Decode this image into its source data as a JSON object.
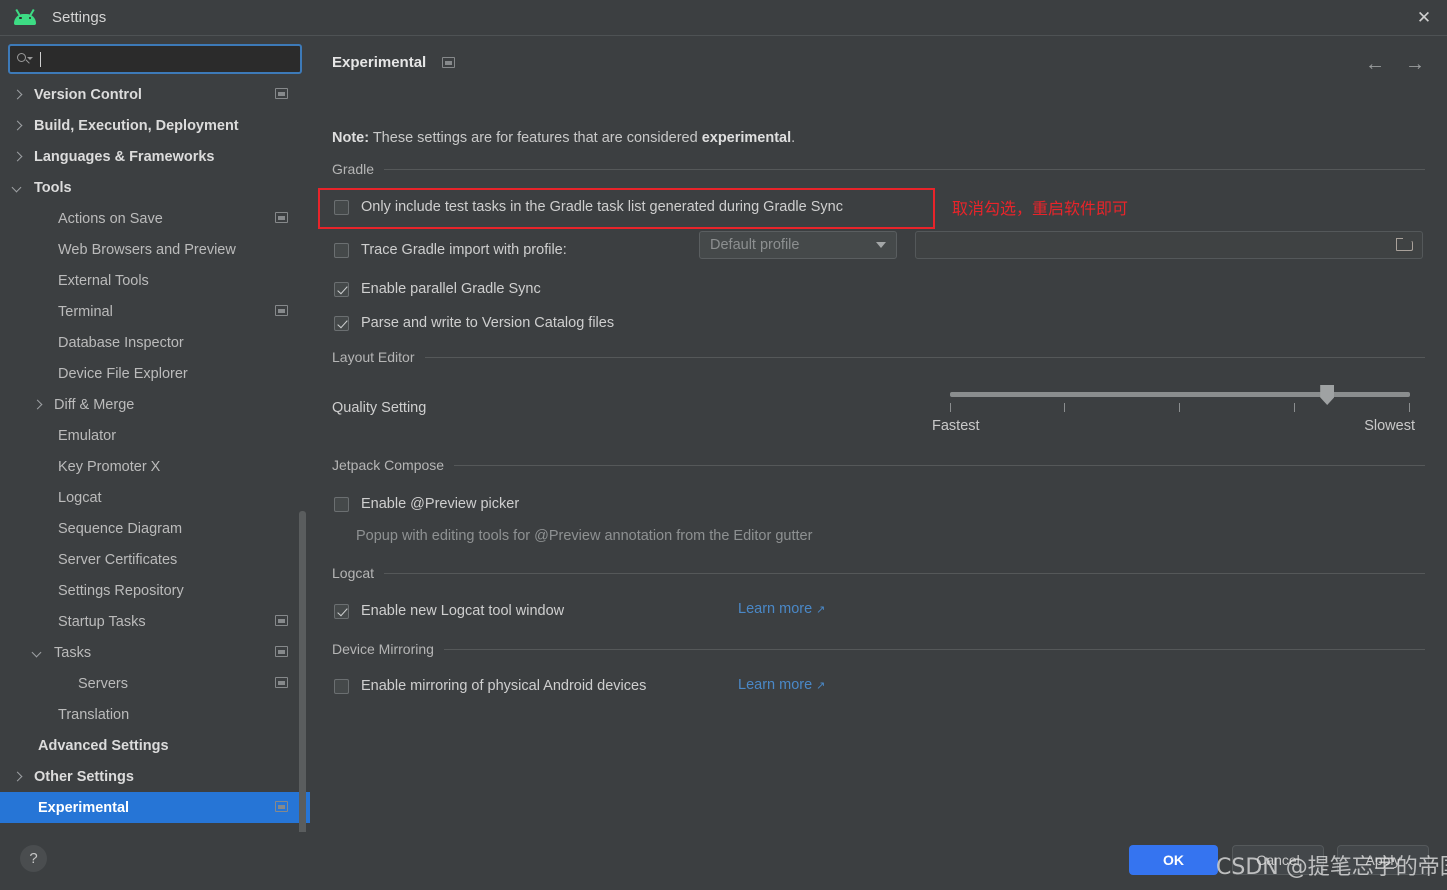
{
  "window": {
    "title": "Settings",
    "logo_icon": "android-logo-icon",
    "close_icon": "✕"
  },
  "search": {
    "placeholder": "",
    "value": "",
    "icon": "search-icon"
  },
  "sidebar": {
    "items": [
      {
        "label": "Version Control",
        "level": 0,
        "bold": true,
        "arrow": "closed",
        "proj": true
      },
      {
        "label": "Build, Execution, Deployment",
        "level": 0,
        "bold": true,
        "arrow": "closed",
        "proj": false
      },
      {
        "label": "Languages & Frameworks",
        "level": 0,
        "bold": true,
        "arrow": "closed",
        "proj": false
      },
      {
        "label": "Tools",
        "level": 0,
        "bold": true,
        "arrow": "open",
        "proj": false
      },
      {
        "label": "Actions on Save",
        "level": 1,
        "bold": false,
        "arrow": "none",
        "proj": true
      },
      {
        "label": "Web Browsers and Preview",
        "level": 1,
        "bold": false,
        "arrow": "none",
        "proj": false
      },
      {
        "label": "External Tools",
        "level": 1,
        "bold": false,
        "arrow": "none",
        "proj": false
      },
      {
        "label": "Terminal",
        "level": 1,
        "bold": false,
        "arrow": "none",
        "proj": true
      },
      {
        "label": "Database Inspector",
        "level": 1,
        "bold": false,
        "arrow": "none",
        "proj": false
      },
      {
        "label": "Device File Explorer",
        "level": 1,
        "bold": false,
        "arrow": "none",
        "proj": false
      },
      {
        "label": "Diff & Merge",
        "level": 1,
        "bold": false,
        "arrow": "closed",
        "proj": false
      },
      {
        "label": "Emulator",
        "level": 1,
        "bold": false,
        "arrow": "none",
        "proj": false
      },
      {
        "label": "Key Promoter X",
        "level": 1,
        "bold": false,
        "arrow": "none",
        "proj": false
      },
      {
        "label": "Logcat",
        "level": 1,
        "bold": false,
        "arrow": "none",
        "proj": false
      },
      {
        "label": "Sequence Diagram",
        "level": 1,
        "bold": false,
        "arrow": "none",
        "proj": false
      },
      {
        "label": "Server Certificates",
        "level": 1,
        "bold": false,
        "arrow": "none",
        "proj": false
      },
      {
        "label": "Settings Repository",
        "level": 1,
        "bold": false,
        "arrow": "none",
        "proj": false
      },
      {
        "label": "Startup Tasks",
        "level": 1,
        "bold": false,
        "arrow": "none",
        "proj": true
      },
      {
        "label": "Tasks",
        "level": 1,
        "bold": false,
        "arrow": "open",
        "proj": true
      },
      {
        "label": "Servers",
        "level": 2,
        "bold": false,
        "arrow": "none",
        "proj": true
      },
      {
        "label": "Translation",
        "level": 1,
        "bold": false,
        "arrow": "none",
        "proj": false
      },
      {
        "label": "Advanced Settings",
        "level": 0,
        "bold": true,
        "arrow": "none",
        "proj": false
      },
      {
        "label": "Other Settings",
        "level": 0,
        "bold": true,
        "arrow": "closed",
        "proj": false
      },
      {
        "label": "Experimental",
        "level": 0,
        "bold": true,
        "arrow": "none",
        "proj": true,
        "selected": true
      }
    ]
  },
  "panel": {
    "title": "Experimental",
    "back_arrow": "←",
    "forward_arrow": "→",
    "note_prefix": "Note:",
    "note_text": " These settings are for features that are considered ",
    "note_emphasis": "experimental",
    "note_suffix": "."
  },
  "sections": {
    "gradle": {
      "title": "Gradle",
      "only_test_tasks": {
        "label": "Only include test tasks in the Gradle task list generated during Gradle Sync",
        "checked": false
      },
      "trace_import": {
        "label": "Trace Gradle import with profile:",
        "checked": false,
        "profile_value": "Default profile",
        "path_value": "",
        "browse_icon": "folder-icon"
      },
      "parallel_sync": {
        "label": "Enable parallel Gradle Sync",
        "checked": true
      },
      "version_catalog": {
        "label": "Parse and write to Version Catalog files",
        "checked": true
      }
    },
    "layout_editor": {
      "title": "Layout Editor",
      "quality_label": "Quality Setting",
      "slider": {
        "min_label": "Fastest",
        "max_label": "Slowest",
        "ticks": 5,
        "value_percent": 82
      }
    },
    "jetpack_compose": {
      "title": "Jetpack Compose",
      "preview_picker": {
        "label": "Enable @Preview picker",
        "checked": false
      },
      "preview_hint": "Popup with editing tools for @Preview annotation from the Editor gutter"
    },
    "logcat": {
      "title": "Logcat",
      "new_logcat": {
        "label": "Enable new Logcat tool window",
        "checked": true
      },
      "learn_more": "Learn more",
      "learn_more_arrow": "↗"
    },
    "device_mirroring": {
      "title": "Device Mirroring",
      "mirroring": {
        "label": "Enable mirroring of physical Android devices",
        "checked": false
      },
      "learn_more": "Learn more",
      "learn_more_arrow": "↗"
    }
  },
  "annotation": {
    "text": "取消勾选，重启软件即可",
    "color": "#e8242a"
  },
  "footer": {
    "help_label": "?",
    "ok_label": "OK",
    "cancel_label": "Cancel",
    "apply_label": "Apply"
  },
  "watermark": {
    "text": "CSDN @提笔忘字的帝国"
  },
  "colors": {
    "accent_blue": "#3574f0",
    "selection_blue": "#2675d6",
    "link_blue": "#4a88c7",
    "annotation_red": "#e8242a",
    "panel_bg": "#3c3f41",
    "android_green": "#3ddc84"
  }
}
